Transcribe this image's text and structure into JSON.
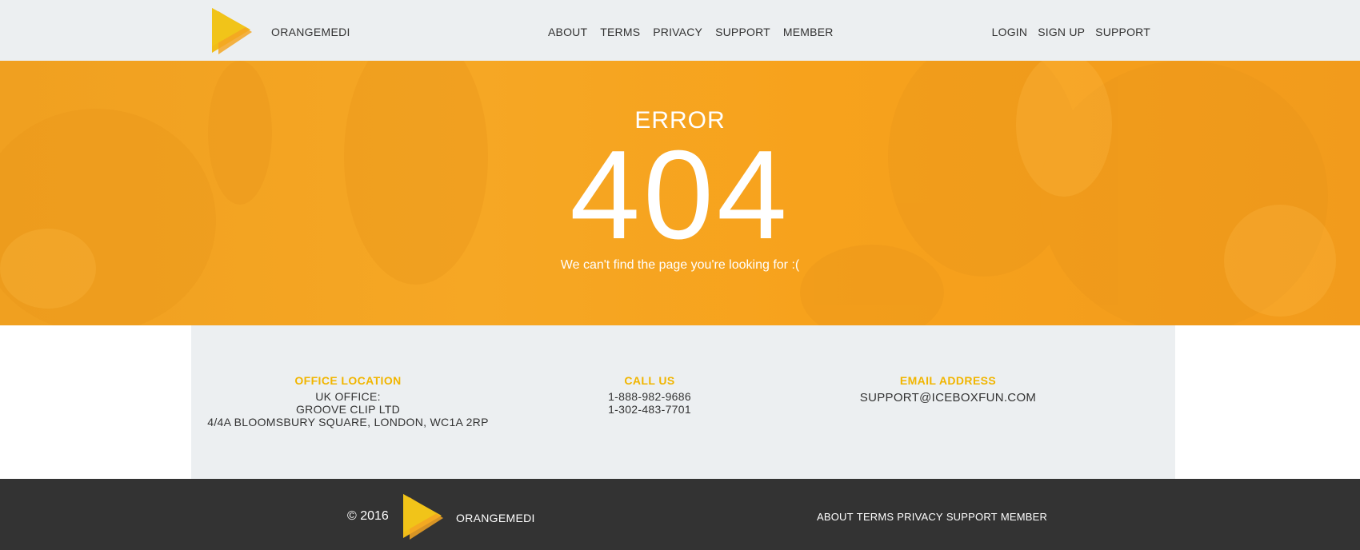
{
  "header": {
    "brand": "ORANGEMEDI",
    "nav_center": [
      "ABOUT",
      "TERMS",
      "PRIVACY",
      "SUPPORT",
      "MEMBER"
    ],
    "nav_right": [
      "LOGIN",
      "SIGN UP",
      "SUPPORT"
    ]
  },
  "hero": {
    "label": "ERROR",
    "code": "404",
    "message": "We can't find the page you're looking for :("
  },
  "contact": {
    "office": {
      "title": "OFFICE LOCATION",
      "lines": [
        "UK OFFICE:",
        "GROOVE CLIP LTD",
        "4/4A BLOOMSBURY SQUARE, LONDON, WC1A 2RP"
      ]
    },
    "call": {
      "title": "CALL US",
      "lines": [
        "1-888-982-9686",
        "1-302-483-7701"
      ]
    },
    "email": {
      "title": "EMAIL ADDRESS",
      "lines": [
        "SUPPORT@ICEBOXFUN.COM"
      ]
    }
  },
  "footer": {
    "copyright": "© 2016",
    "brand": "ORANGEMEDI",
    "nav": [
      "ABOUT",
      "TERMS",
      "PRIVACY",
      "SUPPORT",
      "MEMBER"
    ]
  },
  "colors": {
    "accent": "#f1b500",
    "hero_orange": "#f6a724",
    "header_bg": "#eceff1",
    "footer_bg": "#333333"
  },
  "icons": {
    "logo": "play-triangle-logo-icon"
  }
}
